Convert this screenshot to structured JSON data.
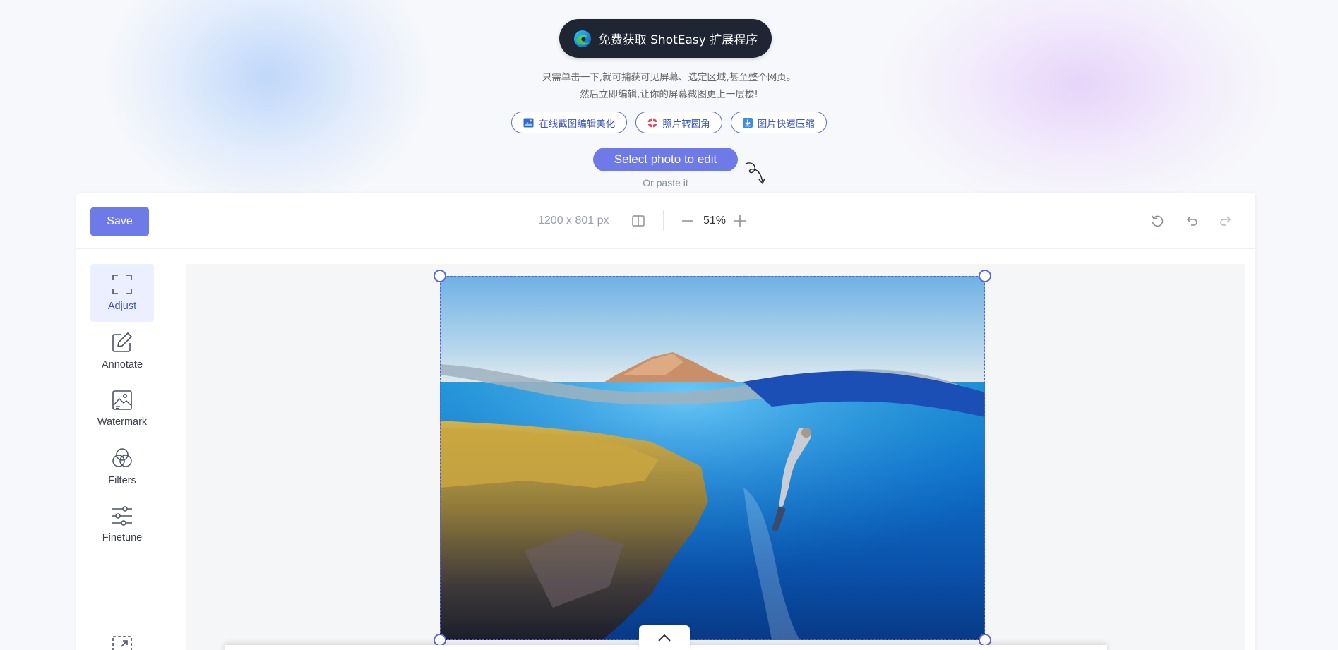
{
  "promo": {
    "extension_label": "免费获取 ShotEasy 扩展程序",
    "tagline_line1": "只需单击一下,就可捕获可见屏幕、选定区域,甚至整个网页。",
    "tagline_line2": "然后立即编辑,让你的屏幕截图更上一层楼!",
    "links": [
      {
        "label": "在线截图编辑美化",
        "icon": "image-edit-icon"
      },
      {
        "label": "照片转圆角",
        "icon": "lifebuoy-icon"
      },
      {
        "label": "图片快速压缩",
        "icon": "download-icon"
      }
    ],
    "select_button": "Select photo to edit",
    "paste_hint": "Or paste it"
  },
  "toolbar": {
    "save_label": "Save",
    "dimensions": "1200 x 801 px",
    "zoom": "51%"
  },
  "sidebar": {
    "items": [
      {
        "label": "Adjust",
        "icon": "crop-corners-icon",
        "active": true
      },
      {
        "label": "Annotate",
        "icon": "pencil-edit-icon",
        "active": false
      },
      {
        "label": "Watermark",
        "icon": "image-watermark-icon",
        "active": false
      },
      {
        "label": "Filters",
        "icon": "color-circles-icon",
        "active": false
      },
      {
        "label": "Finetune",
        "icon": "sliders-icon",
        "active": false
      }
    ]
  },
  "colors": {
    "accent": "#6d7ae8",
    "pill_dark": "#1f2533",
    "link_border": "#5a6fd1",
    "active_bg": "#ebefff"
  }
}
